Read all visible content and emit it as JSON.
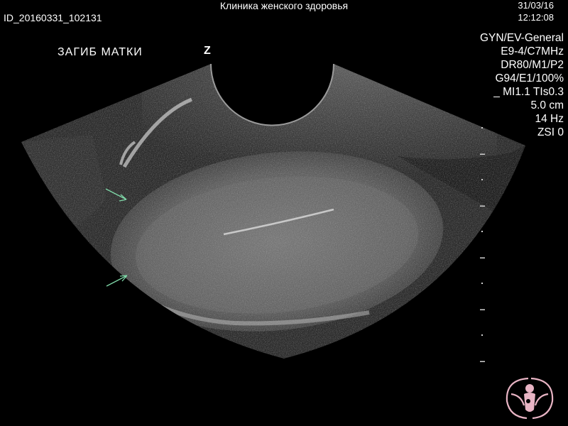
{
  "header": {
    "title": "Клиника женского здоровья",
    "study_id": "ID_20160331_102131",
    "date": "31/03/16",
    "time": "12:12:08"
  },
  "image_label": "ЗАГИБ МАТКИ",
  "zoom_glyph": "Z",
  "parameters": [
    "GYN/EV-General",
    "E9-4/C7MHz",
    "DR80/M1/P2",
    "G94/E1/100%",
    "_ MI1.1  TIs0.3",
    "5.0 cm",
    "14 Hz",
    "ZSI 0"
  ],
  "depth_scale_marks": 10,
  "colors": {
    "text": "#ffffff",
    "arrows": "#7fd8a8",
    "logo": "#e8b4c4"
  },
  "icons": {
    "arrows": "arrow-icon",
    "logo": "clinic-logo-icon"
  }
}
